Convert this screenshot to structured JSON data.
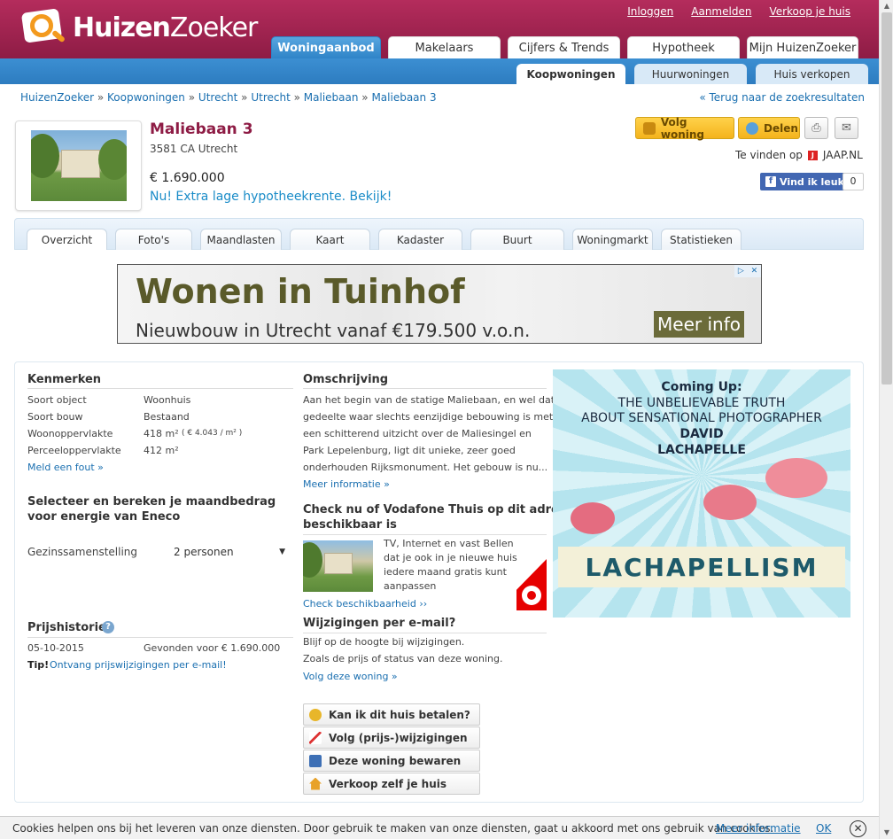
{
  "brand": {
    "name_bold": "Huizen",
    "name_rest": "Zoeker"
  },
  "toplinks": [
    "Inloggen",
    "Aanmelden",
    "Verkoop je huis"
  ],
  "main_tabs": [
    "Woningaanbod",
    "Makelaars",
    "Cijfers & Trends",
    "Hypotheek",
    "Mijn HuizenZoeker"
  ],
  "sub_tabs": [
    "Koopwoningen",
    "Huurwoningen",
    "Huis verkopen"
  ],
  "breadcrumb": [
    "HuizenZoeker",
    "Koopwoningen",
    "Utrecht",
    "Utrecht",
    "Maliebaan",
    "Maliebaan 3"
  ],
  "back_link": "« Terug naar de zoekresultaten",
  "listing": {
    "title": "Maliebaan 3",
    "address": "3581 CA Utrecht",
    "price": "€ 1.690.000",
    "promo": "Nu! Extra lage hypotheekrente. Bekijk!"
  },
  "actions": {
    "follow": "Volg woning",
    "share": "Delen",
    "te_vinden": "Te vinden op",
    "jaap": "JAAP.NL",
    "fb_like": "Vind ik leuk",
    "fb_count": "0"
  },
  "property_tabs": [
    "Overzicht",
    "Foto's",
    "Maandlasten",
    "Kaart",
    "Kadaster",
    "Buurt",
    "Woningmarkt",
    "Statistieken"
  ],
  "ad_top": {
    "headline": "Wonen in Tuinhof",
    "sub": "Nieuwbouw in Utrecht vanaf €179.500 v.o.n.",
    "cta": "Meer info"
  },
  "kenmerken": {
    "title": "Kenmerken",
    "rows": [
      {
        "label": "Soort object",
        "value": "Woonhuis"
      },
      {
        "label": "Soort bouw",
        "value": "Bestaand"
      },
      {
        "label": "Woonoppervlakte",
        "value": "418 m²",
        "extra": "( € 4.043 / m² )"
      },
      {
        "label": "Perceeloppervlakte",
        "value": "412 m²"
      }
    ],
    "report": "Meld een fout »"
  },
  "energie": {
    "title_l1": "Selecteer en bereken je maandbedrag",
    "title_l2": "voor energie van Eneco",
    "label": "Gezinssamenstelling",
    "selected": "2 personen"
  },
  "prijshistorie": {
    "title": "Prijshistorie",
    "date": "05-10-2015",
    "event": "Gevonden voor € 1.690.000",
    "tip_label": "Tip!",
    "tip_link": "Ontvang prijswijzigingen per e-mail!"
  },
  "omschrijving": {
    "title": "Omschrijving",
    "lines": [
      "Aan het begin van de statige Maliebaan, en wel dat",
      "gedeelte waar slechts eenzijdige bebouwing is met",
      "een schitterend uitzicht over de Maliesingel en",
      "Park Lepelenburg, ligt dit unieke, zeer goed",
      "onderhouden Rijksmonument. Het gebouw is nu..."
    ],
    "more": "Meer informatie »"
  },
  "vodafone": {
    "title_l1": "Check nu of Vodafone Thuis op dit adres",
    "title_l2": "beschikbaar is",
    "lines": [
      "TV, Internet en vast Bellen",
      "dat je ook in je nieuwe huis",
      "iedere maand gratis kunt",
      "aanpassen"
    ],
    "link": "Check beschikbaarheid ››"
  },
  "email": {
    "title": "Wijzigingen per e-mail?",
    "l1": "Blijf op de hoogte bij wijzigingen.",
    "l2": "Zoals de prijs of status van deze woning.",
    "link": "Volg deze woning »"
  },
  "action_buttons": [
    "Kan ik dit huis betalen?",
    "Volg (prijs-)wijzigingen",
    "Deze woning bewaren",
    "Verkoop zelf je huis"
  ],
  "ad_side": {
    "l1": "Coming Up:",
    "l2": "THE UNBELIEVABLE TRUTH",
    "l3": "ABOUT SENSATIONAL PHOTOGRAPHER",
    "l4": "DAVID",
    "l5": "LACHAPELLE",
    "band": "LACHAPELLISM"
  },
  "cookie": {
    "text": "Cookies helpen ons bij het leveren van onze diensten. Door gebruik te maken van onze diensten, gaat u akkoord met ons gebruik van cookies.",
    "more": "Meer informatie",
    "ok": "OK",
    "close": "✕"
  },
  "colors": {
    "brand": "#8e1c45",
    "accent_blue": "#2f84c8",
    "link": "#1a6fb0",
    "button_yellow": "#f4b31c"
  }
}
